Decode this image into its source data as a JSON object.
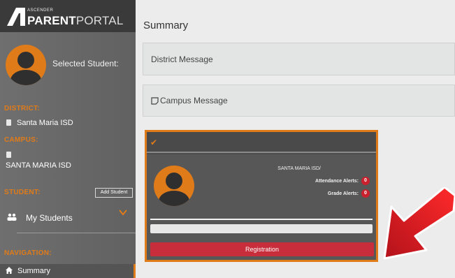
{
  "app": {
    "logo_small": "ASCENDER",
    "logo_bold": "PARENT",
    "logo_thin": "PORTAL"
  },
  "sidebar": {
    "selected_student_label": "Selected Student:",
    "district_label": "DISTRICT:",
    "district_value": "Santa Maria ISD",
    "campus_label": "CAMPUS:",
    "campus_value": "SANTA MARIA ISD",
    "student_label": "STUDENT:",
    "add_student_label": "Add Student",
    "my_students_label": "My Students",
    "navigation_label": "NAVIGATION:",
    "nav_summary_label": "Summary"
  },
  "main": {
    "title": "Summary",
    "district_message_label": "District Message",
    "campus_message_label": "Campus Message"
  },
  "student_card": {
    "district": "SANTA MARIA ISD/",
    "attendance_alerts_label": "Attendance Alerts:",
    "attendance_alerts_count": "0",
    "grade_alerts_label": "Grade Alerts:",
    "grade_alerts_count": "0",
    "registration_label": "Registration"
  },
  "colors": {
    "accent_orange": "#e07b1a",
    "alert_red": "#c8202c",
    "registration_red": "#c72d3a"
  },
  "icons": [
    "ascender-logo-icon",
    "doc-icon",
    "users-icon",
    "chevron-down-icon",
    "home-icon",
    "note-icon",
    "checkmark-icon",
    "avatar-placeholder",
    "red-arrow"
  ]
}
